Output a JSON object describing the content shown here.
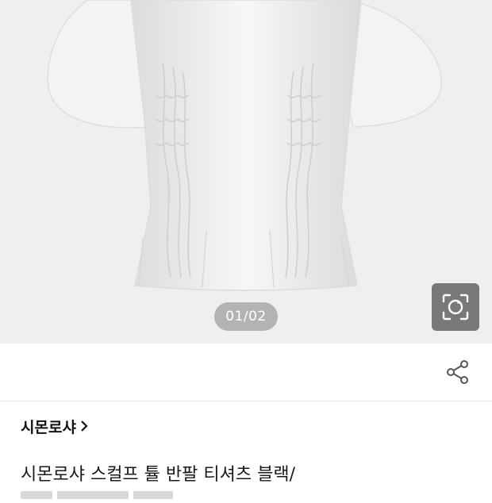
{
  "gallery": {
    "counter": "01/02",
    "image_alt": "white pleated puff-sleeve blouse",
    "background": "#efefef"
  },
  "actions": {
    "lens_icon": "camera-lens-icon",
    "share_icon": "share-icon"
  },
  "product": {
    "brand": "시몬로샤",
    "title": "시몬로샤 스컬프 튤 반팔 티셔츠 블랙/"
  }
}
